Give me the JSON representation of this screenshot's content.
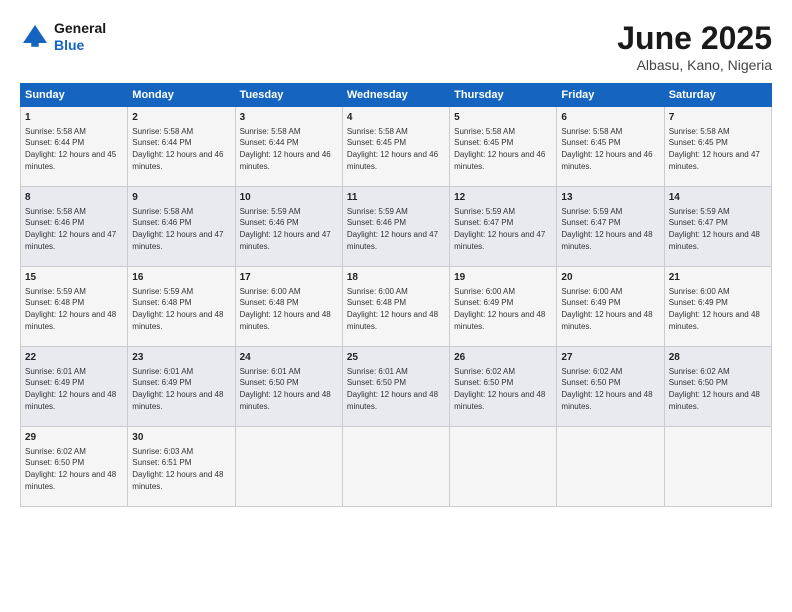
{
  "logo": {
    "general": "General",
    "blue": "Blue"
  },
  "header": {
    "month_year": "June 2025",
    "location": "Albasu, Kano, Nigeria"
  },
  "weekdays": [
    "Sunday",
    "Monday",
    "Tuesday",
    "Wednesday",
    "Thursday",
    "Friday",
    "Saturday"
  ],
  "weeks": [
    [
      {
        "day": "1",
        "sunrise": "Sunrise: 5:58 AM",
        "sunset": "Sunset: 6:44 PM",
        "daylight": "Daylight: 12 hours and 45 minutes."
      },
      {
        "day": "2",
        "sunrise": "Sunrise: 5:58 AM",
        "sunset": "Sunset: 6:44 PM",
        "daylight": "Daylight: 12 hours and 46 minutes."
      },
      {
        "day": "3",
        "sunrise": "Sunrise: 5:58 AM",
        "sunset": "Sunset: 6:44 PM",
        "daylight": "Daylight: 12 hours and 46 minutes."
      },
      {
        "day": "4",
        "sunrise": "Sunrise: 5:58 AM",
        "sunset": "Sunset: 6:45 PM",
        "daylight": "Daylight: 12 hours and 46 minutes."
      },
      {
        "day": "5",
        "sunrise": "Sunrise: 5:58 AM",
        "sunset": "Sunset: 6:45 PM",
        "daylight": "Daylight: 12 hours and 46 minutes."
      },
      {
        "day": "6",
        "sunrise": "Sunrise: 5:58 AM",
        "sunset": "Sunset: 6:45 PM",
        "daylight": "Daylight: 12 hours and 46 minutes."
      },
      {
        "day": "7",
        "sunrise": "Sunrise: 5:58 AM",
        "sunset": "Sunset: 6:45 PM",
        "daylight": "Daylight: 12 hours and 47 minutes."
      }
    ],
    [
      {
        "day": "8",
        "sunrise": "Sunrise: 5:58 AM",
        "sunset": "Sunset: 6:46 PM",
        "daylight": "Daylight: 12 hours and 47 minutes."
      },
      {
        "day": "9",
        "sunrise": "Sunrise: 5:58 AM",
        "sunset": "Sunset: 6:46 PM",
        "daylight": "Daylight: 12 hours and 47 minutes."
      },
      {
        "day": "10",
        "sunrise": "Sunrise: 5:59 AM",
        "sunset": "Sunset: 6:46 PM",
        "daylight": "Daylight: 12 hours and 47 minutes."
      },
      {
        "day": "11",
        "sunrise": "Sunrise: 5:59 AM",
        "sunset": "Sunset: 6:46 PM",
        "daylight": "Daylight: 12 hours and 47 minutes."
      },
      {
        "day": "12",
        "sunrise": "Sunrise: 5:59 AM",
        "sunset": "Sunset: 6:47 PM",
        "daylight": "Daylight: 12 hours and 47 minutes."
      },
      {
        "day": "13",
        "sunrise": "Sunrise: 5:59 AM",
        "sunset": "Sunset: 6:47 PM",
        "daylight": "Daylight: 12 hours and 48 minutes."
      },
      {
        "day": "14",
        "sunrise": "Sunrise: 5:59 AM",
        "sunset": "Sunset: 6:47 PM",
        "daylight": "Daylight: 12 hours and 48 minutes."
      }
    ],
    [
      {
        "day": "15",
        "sunrise": "Sunrise: 5:59 AM",
        "sunset": "Sunset: 6:48 PM",
        "daylight": "Daylight: 12 hours and 48 minutes."
      },
      {
        "day": "16",
        "sunrise": "Sunrise: 5:59 AM",
        "sunset": "Sunset: 6:48 PM",
        "daylight": "Daylight: 12 hours and 48 minutes."
      },
      {
        "day": "17",
        "sunrise": "Sunrise: 6:00 AM",
        "sunset": "Sunset: 6:48 PM",
        "daylight": "Daylight: 12 hours and 48 minutes."
      },
      {
        "day": "18",
        "sunrise": "Sunrise: 6:00 AM",
        "sunset": "Sunset: 6:48 PM",
        "daylight": "Daylight: 12 hours and 48 minutes."
      },
      {
        "day": "19",
        "sunrise": "Sunrise: 6:00 AM",
        "sunset": "Sunset: 6:49 PM",
        "daylight": "Daylight: 12 hours and 48 minutes."
      },
      {
        "day": "20",
        "sunrise": "Sunrise: 6:00 AM",
        "sunset": "Sunset: 6:49 PM",
        "daylight": "Daylight: 12 hours and 48 minutes."
      },
      {
        "day": "21",
        "sunrise": "Sunrise: 6:00 AM",
        "sunset": "Sunset: 6:49 PM",
        "daylight": "Daylight: 12 hours and 48 minutes."
      }
    ],
    [
      {
        "day": "22",
        "sunrise": "Sunrise: 6:01 AM",
        "sunset": "Sunset: 6:49 PM",
        "daylight": "Daylight: 12 hours and 48 minutes."
      },
      {
        "day": "23",
        "sunrise": "Sunrise: 6:01 AM",
        "sunset": "Sunset: 6:49 PM",
        "daylight": "Daylight: 12 hours and 48 minutes."
      },
      {
        "day": "24",
        "sunrise": "Sunrise: 6:01 AM",
        "sunset": "Sunset: 6:50 PM",
        "daylight": "Daylight: 12 hours and 48 minutes."
      },
      {
        "day": "25",
        "sunrise": "Sunrise: 6:01 AM",
        "sunset": "Sunset: 6:50 PM",
        "daylight": "Daylight: 12 hours and 48 minutes."
      },
      {
        "day": "26",
        "sunrise": "Sunrise: 6:02 AM",
        "sunset": "Sunset: 6:50 PM",
        "daylight": "Daylight: 12 hours and 48 minutes."
      },
      {
        "day": "27",
        "sunrise": "Sunrise: 6:02 AM",
        "sunset": "Sunset: 6:50 PM",
        "daylight": "Daylight: 12 hours and 48 minutes."
      },
      {
        "day": "28",
        "sunrise": "Sunrise: 6:02 AM",
        "sunset": "Sunset: 6:50 PM",
        "daylight": "Daylight: 12 hours and 48 minutes."
      }
    ],
    [
      {
        "day": "29",
        "sunrise": "Sunrise: 6:02 AM",
        "sunset": "Sunset: 6:50 PM",
        "daylight": "Daylight: 12 hours and 48 minutes."
      },
      {
        "day": "30",
        "sunrise": "Sunrise: 6:03 AM",
        "sunset": "Sunset: 6:51 PM",
        "daylight": "Daylight: 12 hours and 48 minutes."
      },
      {
        "day": "",
        "sunrise": "",
        "sunset": "",
        "daylight": ""
      },
      {
        "day": "",
        "sunrise": "",
        "sunset": "",
        "daylight": ""
      },
      {
        "day": "",
        "sunrise": "",
        "sunset": "",
        "daylight": ""
      },
      {
        "day": "",
        "sunrise": "",
        "sunset": "",
        "daylight": ""
      },
      {
        "day": "",
        "sunrise": "",
        "sunset": "",
        "daylight": ""
      }
    ]
  ]
}
